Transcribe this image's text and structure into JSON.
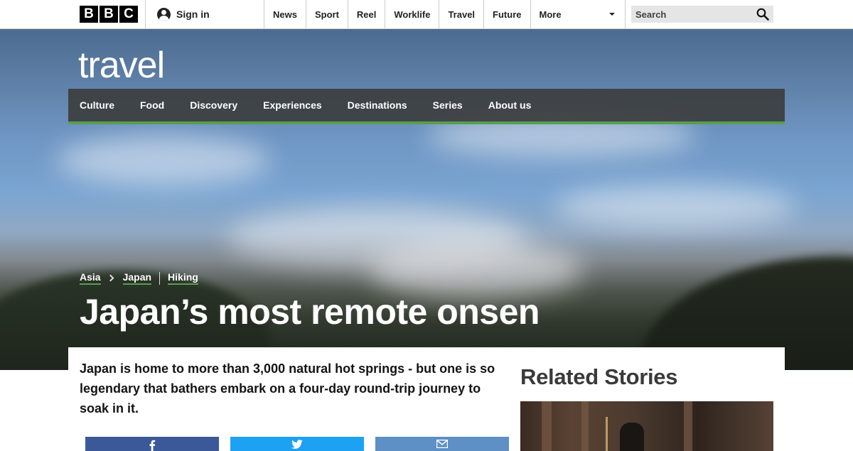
{
  "topbar": {
    "logo_letters": [
      "B",
      "B",
      "C"
    ],
    "signin_label": "Sign in",
    "nav": [
      "News",
      "Sport",
      "Reel",
      "Worklife",
      "Travel",
      "Future"
    ],
    "more_label": "More",
    "search_placeholder": "Search"
  },
  "brand": "travel",
  "section_nav": [
    "Culture",
    "Food",
    "Discovery",
    "Experiences",
    "Destinations",
    "Series",
    "About us"
  ],
  "breadcrumbs": [
    "Asia",
    "Japan",
    "Hiking"
  ],
  "headline": "Japan’s most remote onsen",
  "summary": "Japan is home to more than 3,000 natural hot springs - but one is so legendary that bathers embark on a four-day round-trip journey to soak in it.",
  "related_title": "Related Stories",
  "colors": {
    "accent_green": "#589e50",
    "section_nav_bg": "#3c3e40",
    "facebook": "#3b5998",
    "twitter": "#1da1f2",
    "email": "#5e8fc5"
  },
  "icons": {
    "signin": "user-avatar-icon",
    "more": "caret-down-icon",
    "search": "magnifier-icon",
    "facebook": "facebook-f-icon",
    "twitter": "twitter-bird-icon",
    "email": "envelope-icon"
  }
}
